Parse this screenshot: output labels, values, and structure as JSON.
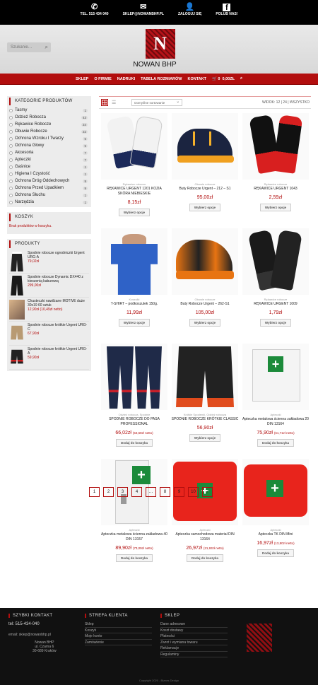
{
  "topbar": [
    {
      "icon": "phone-icon",
      "glyph": "✆",
      "label": "TEL. 515 434 040"
    },
    {
      "icon": "mail-icon",
      "glyph": "✉",
      "label": "SKLEP@NOWANBHP.PL"
    },
    {
      "icon": "user-icon",
      "glyph": "👤",
      "label": "ZALOGUJ SIĘ"
    },
    {
      "icon": "facebook-icon",
      "glyph": "f",
      "label": "POLUB NAS!"
    }
  ],
  "search": {
    "placeholder": "Szukanie…"
  },
  "logo": {
    "letter": "N",
    "name": "NOWAN BHP"
  },
  "nav": {
    "items": [
      "SKLEP",
      "O FIRMIE",
      "NADRUKI",
      "TABELA ROZMIARÓW",
      "KONTAKT"
    ],
    "cart_count": "0",
    "cart_total": "0,00ZŁ"
  },
  "sidebar": {
    "categories_title": "KATEGORIE PRODUKTÓW",
    "categories": [
      {
        "name": "Tasmy",
        "count": "1"
      },
      {
        "name": "Odzież Robocza",
        "count": "43"
      },
      {
        "name": "Rękawice Robocze",
        "count": "24"
      },
      {
        "name": "Obuwie Robocze",
        "count": "22"
      },
      {
        "name": "Ochrona Wzroku I Twarzy",
        "count": "5"
      },
      {
        "name": "Ochrona Głowy",
        "count": "5"
      },
      {
        "name": "Akcesoria",
        "count": "7"
      },
      {
        "name": "Apteczki",
        "count": "7"
      },
      {
        "name": "Gaśnice",
        "count": "1"
      },
      {
        "name": "Higiena I Czystość",
        "count": "1"
      },
      {
        "name": "Ochrona Dróg Oddechowych",
        "count": "9"
      },
      {
        "name": "Ochrona Przed Upadkiem",
        "count": "9"
      },
      {
        "name": "Ochrona Słuchu",
        "count": "1"
      },
      {
        "name": "Narzędzia",
        "count": "1"
      }
    ],
    "cart_title": "KOSZYK",
    "cart_empty": "Brak produktów w koszyku.",
    "products_title": "PRODUKTY",
    "products": [
      {
        "title": "Spodnie robocze ogrodniczki Urgent URG-A",
        "price": "79,02zł"
      },
      {
        "title": "Spodnie robocze Dynamic DX440 z kieszenią kaburową",
        "price": "299,00zł"
      },
      {
        "title": "Chusteczki nawilżane MOTIVE duże 30x19 60 sztuk",
        "price": "12,90zł (10,49zł netto)"
      },
      {
        "title": "Spodnie robocze krótkie Urgent URG-C",
        "price": "67,90zł"
      },
      {
        "title": "Spodnie robocze krótkie Urgent URG-A",
        "price": "59,90zł"
      }
    ]
  },
  "toolbar": {
    "sort": "Domyślne sortowanie",
    "per_page": "WIDOK: 12 | 24 | WSZYSTKO"
  },
  "products": [
    {
      "cat": "Rękawice robocze",
      "title": "RĘKAWICE URGENT 1201 KOZIA SKÓRA NIEBIESKIE",
      "price": "8,15zł",
      "net": "",
      "btn": "Wybierz opcje",
      "img": "gloves-blue"
    },
    {
      "cat": "Obuwie robocze",
      "title": "Buty Robocze Urgent – 212 – S1",
      "price": "95,00zł",
      "net": "",
      "btn": "Wybierz opcje",
      "img": "shoe-navy"
    },
    {
      "cat": "Rękawice robocze",
      "title": "RĘKAWICE URGENT 1043",
      "price": "2,59zł",
      "net": "",
      "btn": "Wybierz opcje",
      "img": "gloves-red"
    },
    {
      "cat": "Koszulki",
      "title": "T-SHIRT – podkoszulek 150g.",
      "price": "11,99zł",
      "net": "",
      "btn": "Wybierz opcje",
      "img": "tshirt"
    },
    {
      "cat": "Obuwie robocze",
      "title": "Buty Robocze Urgent – 262-S1",
      "price": "105,00zł",
      "net": "",
      "btn": "Wybierz opcje",
      "img": "shoe-orange"
    },
    {
      "cat": "Rękawice robocze",
      "title": "RĘKAWICE URGENT 1009",
      "price": "1,79zł",
      "net": "",
      "btn": "Wybierz opcje",
      "img": "gloves-black"
    },
    {
      "cat": "Odzież robocza, Spodnie",
      "title": "SPODNIE ROBOCZE DO PASA PROFESSIONAL",
      "price": "66,02zł",
      "net": "(53,68zł netto)",
      "btn": "Dodaj do koszyka",
      "img": "trousers"
    },
    {
      "cat": "Krótkie Spodenki, Odzież robocza",
      "title": "SPODNIE ROBOCZE KRÓTKIE CLASSIC",
      "price": "56,90zł",
      "net": "",
      "btn": "Wybierz opcje",
      "img": "shorts"
    },
    {
      "cat": "Apteczki",
      "title": "Apteczka metalowa ścienna zakładowa 20 DIN 13164",
      "price": "75,90zł",
      "net": "(61,71zł netto)",
      "btn": "Dodaj do koszyka",
      "img": "cabinet"
    },
    {
      "cat": "Apteczki",
      "title": "Apteczka metalowa ścienna zakładowa 40 DIN 13157",
      "price": "89,90zł",
      "net": "(73,09zł netto)",
      "btn": "Dodaj do koszyka",
      "img": "cabinet-open"
    },
    {
      "cat": "Apteczki",
      "title": "Apteczka samochodowa materiał DIN 13164",
      "price": "26,97zł",
      "net": "(21,93zł netto)",
      "btn": "Dodaj do koszyka",
      "img": "kit-red"
    },
    {
      "cat": "Apteczki",
      "title": "Apteczka TK DIN Mini",
      "price": "16,97zł",
      "net": "(13,80zł netto)",
      "btn": "Dodaj do koszyka",
      "img": "kit-red2"
    }
  ],
  "pager": [
    "1",
    "2",
    "3",
    "4",
    "…",
    "8",
    "9",
    "10",
    "›"
  ],
  "footer": {
    "contact_title": "SZYBKI KONTAKT",
    "tel": "tel:  515-434-040",
    "email": "email: sklep@nowanbhp.pl",
    "address": [
      "Nowan BHP",
      "ul. Czarna 6",
      "30-689 Kraków"
    ],
    "client_title": "STREFA KLIENTA",
    "client_links": [
      "Sklep",
      "Koszyk",
      "Moje konto",
      "Zamówienie"
    ],
    "shop_title": "SKLEP",
    "shop_links": [
      "Dane adresowe",
      "Koszt dostawy",
      "Płatności",
      "Zwrot i wymiana towaru",
      "Reklamacje",
      "Regulaminy"
    ],
    "copyright": "Copyright 2020 - Biznes Design"
  }
}
